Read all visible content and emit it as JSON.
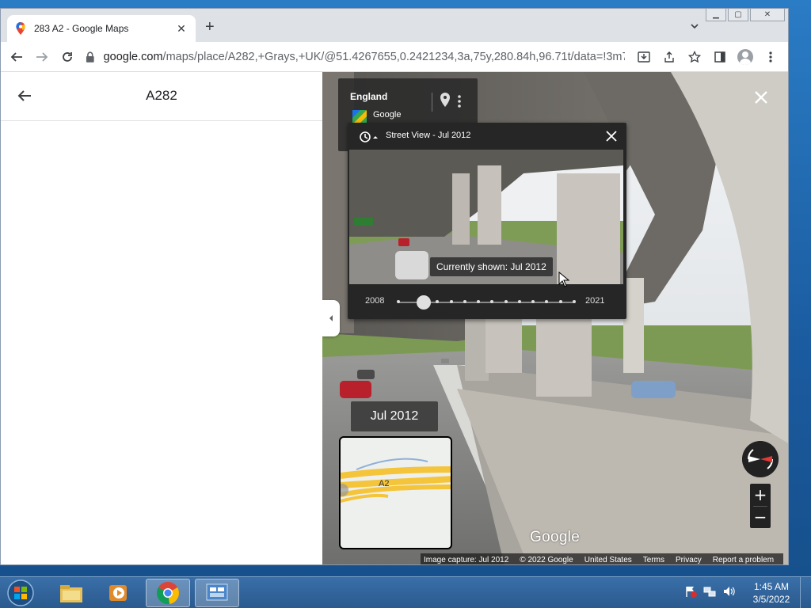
{
  "browser": {
    "tab_title": "283 A2 - Google Maps",
    "url_host": "google.com",
    "url_path": "/maps/place/A282,+Grays,+UK/@51.4267655,0.2421234,3a,75y,280.84h,96.71t/data=!3m7!..."
  },
  "sidepanel": {
    "title": "A282"
  },
  "streetview": {
    "region": "England",
    "provider": "Google",
    "timemachine": {
      "title": "Street View - Jul 2012",
      "tooltip": "Currently shown: Jul 2012",
      "start_year": "2008",
      "end_year": "2021",
      "selected_index": 1,
      "stop_count": 13
    },
    "date_badge": "Jul 2012",
    "minimap_label": "A2",
    "watermark": "Google",
    "footer": {
      "capture": "Image capture: Jul 2012",
      "copyright": "© 2022 Google",
      "region": "United States",
      "terms": "Terms",
      "privacy": "Privacy",
      "report": "Report a problem"
    }
  },
  "taskbar": {
    "time": "1:45 AM",
    "date": "3/5/2022"
  },
  "colors": {
    "maps_road": "#f4c43a",
    "panel_dark": "#262626",
    "taskbar": "#2a5a8e"
  }
}
